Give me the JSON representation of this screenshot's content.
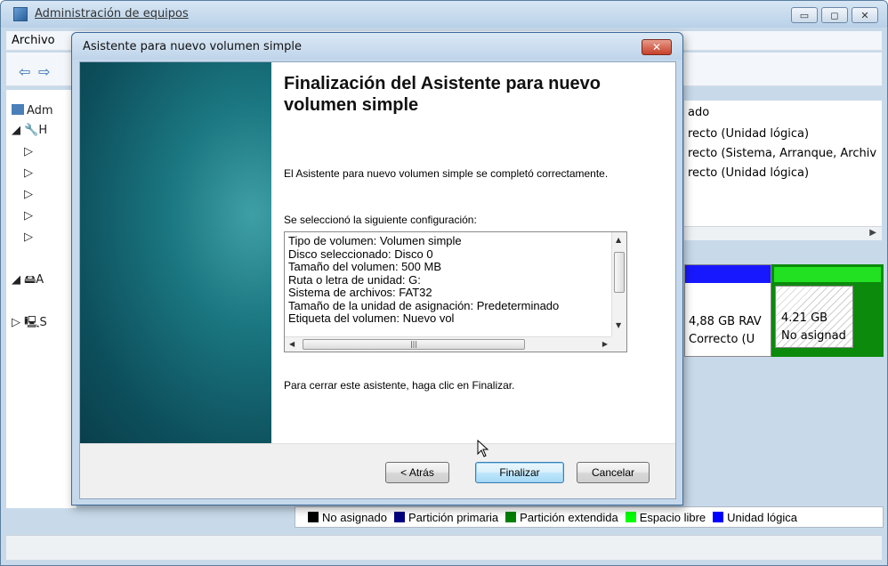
{
  "main": {
    "title": "Administración de equipos",
    "menu": [
      "Archivo"
    ],
    "tree_items": [
      "Adm",
      "H",
      "A",
      "S"
    ],
    "status_header": "ado",
    "status_rows": [
      "recto (Unidad lógica)",
      "recto (Sistema, Arranque, Archiv",
      "recto (Unidad lógica)"
    ],
    "disk_volume_size": "4,88 GB RAV",
    "disk_volume_state": "Correcto (U",
    "disk_free_size": "4.21 GB",
    "disk_free_label": "No asignad",
    "legend": [
      {
        "label": "No asignado",
        "color": "#000000"
      },
      {
        "label": "Partición primaria",
        "color": "#000080"
      },
      {
        "label": "Partición extendida",
        "color": "#008000"
      },
      {
        "label": "Espacio libre",
        "color": "#00ff00"
      },
      {
        "label": "Unidad lógica",
        "color": "#0000ff"
      }
    ]
  },
  "dialog": {
    "title": "Asistente para nuevo volumen simple",
    "heading": "Finalización del Asistente para nuevo volumen simple",
    "completed_text": "El Asistente para nuevo volumen simple se completó correctamente.",
    "config_label": "Se seleccionó la siguiente configuración:",
    "config_lines": [
      "Tipo de volumen: Volumen simple",
      "Disco seleccionado: Disco 0",
      "Tamaño del volumen: 500 MB",
      "Ruta o letra de unidad: G:",
      "Sistema de archivos: FAT32",
      "Tamaño de la unidad de asignación: Predeterminado",
      "Etiqueta del volumen: Nuevo vol"
    ],
    "close_text": "Para cerrar este asistente, haga clic en Finalizar.",
    "buttons": {
      "back": "< Atrás",
      "finish": "Finalizar",
      "cancel": "Cancelar"
    }
  },
  "icons": [
    "computer-icon",
    "back-arrow-icon",
    "forward-arrow-icon",
    "close-icon",
    "minimize-icon",
    "maximize-icon",
    "mouse-pointer-icon"
  ]
}
